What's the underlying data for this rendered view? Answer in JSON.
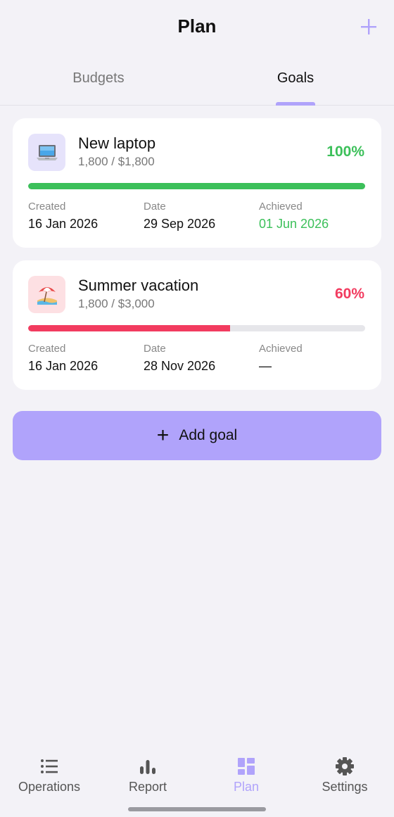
{
  "header": {
    "title": "Plan",
    "add_icon": "plus-icon",
    "accent": "#b0a3fb"
  },
  "tabs": [
    {
      "label": "Budgets",
      "active": false
    },
    {
      "label": "Goals",
      "active": true
    }
  ],
  "goals": [
    {
      "icon": "laptop-icon",
      "icon_bg": "#e6e3fb",
      "name": "New laptop",
      "amount": "1,800 / $1,800",
      "percent": "100%",
      "progress": 1.0,
      "color": "#3cc05a",
      "created_label": "Created",
      "created": "16 Jan 2026",
      "date_label": "Date",
      "date": "29 Sep 2026",
      "achieved_label": "Achieved",
      "achieved": "01 Jun 2026"
    },
    {
      "icon": "beach-umbrella-icon",
      "icon_bg": "#fde0e3",
      "name": "Summer vacation",
      "amount": "1,800 / $3,000",
      "percent": "60%",
      "progress": 0.6,
      "color": "#f23b5f",
      "created_label": "Created",
      "created": "16 Jan 2026",
      "date_label": "Date",
      "date": "28 Nov 2026",
      "achieved_label": "Achieved",
      "achieved": "—"
    }
  ],
  "add_goal": {
    "plus": "+",
    "label": "Add goal"
  },
  "nav": [
    {
      "label": "Operations",
      "icon": "list-icon",
      "active": false
    },
    {
      "label": "Report",
      "icon": "bar-chart-icon",
      "active": false
    },
    {
      "label": "Plan",
      "icon": "dashboard-icon",
      "active": true
    },
    {
      "label": "Settings",
      "icon": "gear-icon",
      "active": false
    }
  ]
}
